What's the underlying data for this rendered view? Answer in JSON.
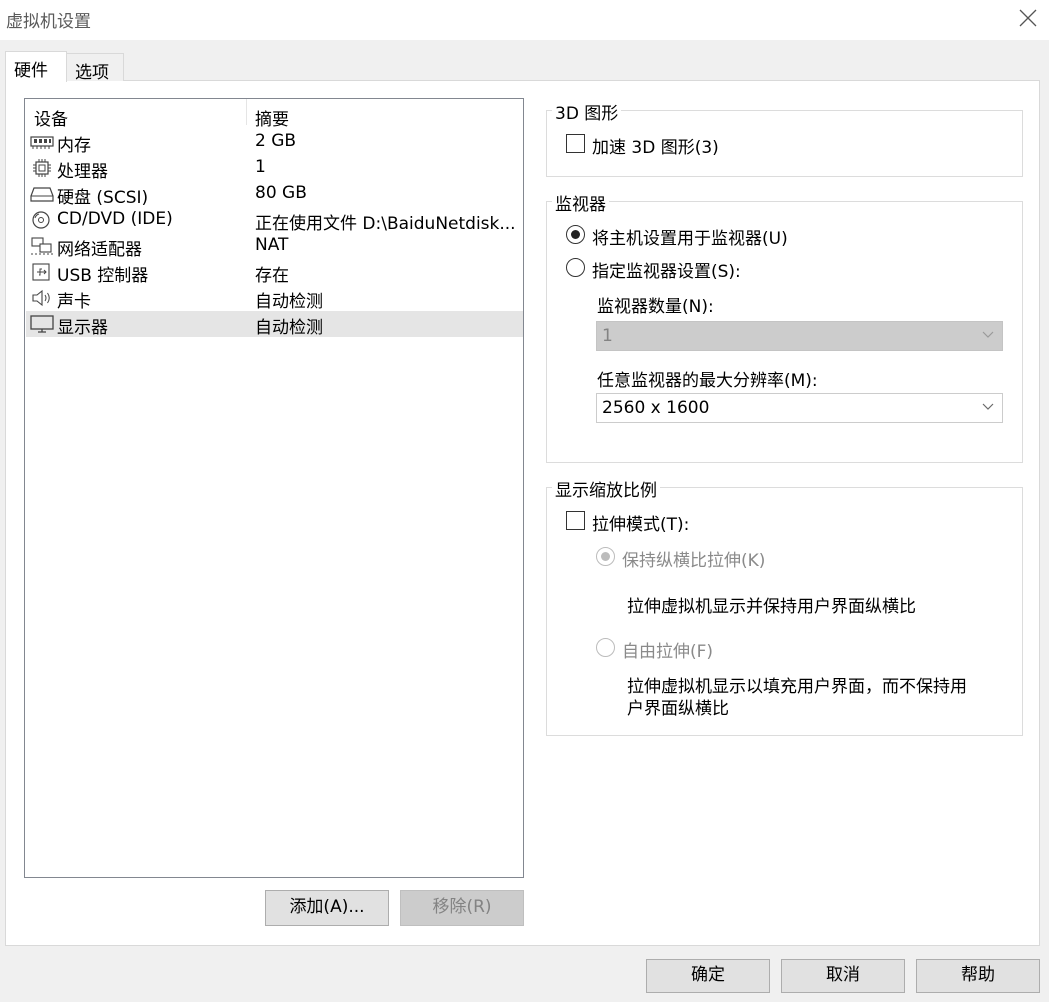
{
  "window": {
    "title": "虚拟机设置"
  },
  "tabs": [
    {
      "label": "硬件",
      "selected": true
    },
    {
      "label": "选项",
      "selected": false
    }
  ],
  "device_list": {
    "headers": {
      "device": "设备",
      "summary": "摘要"
    },
    "rows": [
      {
        "name": "内存",
        "summary": "2 GB",
        "icon": "memory-icon"
      },
      {
        "name": "处理器",
        "summary": "1",
        "icon": "processor-icon"
      },
      {
        "name": "硬盘 (SCSI)",
        "summary": "80 GB",
        "icon": "hard-disk-icon"
      },
      {
        "name": "CD/DVD (IDE)",
        "summary": "正在使用文件 D:\\BaiduNetdisk...",
        "icon": "cd-dvd-icon"
      },
      {
        "name": "网络适配器",
        "summary": "NAT",
        "icon": "network-adapter-icon"
      },
      {
        "name": "USB 控制器",
        "summary": "存在",
        "icon": "usb-icon"
      },
      {
        "name": "声卡",
        "summary": "自动检测",
        "icon": "speaker-icon"
      },
      {
        "name": "显示器",
        "summary": "自动检测",
        "icon": "display-icon",
        "selected": true
      }
    ]
  },
  "list_buttons": {
    "add": "添加(A)...",
    "remove": "移除(R)"
  },
  "graphics_3d": {
    "title": "3D 图形",
    "accelerate_label": "加速 3D 图形(3)",
    "accelerate_checked": false
  },
  "monitor": {
    "title": "监视器",
    "use_host_label": "将主机设置用于监视器(U)",
    "use_host_selected": true,
    "specify_label": "指定监视器设置(S):",
    "specify_selected": false,
    "count_label": "监视器数量(N):",
    "count_value": "1",
    "max_res_label": "任意监视器的最大分辨率(M):",
    "max_res_value": "2560 x 1600"
  },
  "display_scaling": {
    "title": "显示缩放比例",
    "stretch_label": "拉伸模式(T):",
    "stretch_checked": false,
    "keep_aspect_label": "保持纵横比拉伸(K)",
    "keep_aspect_selected": true,
    "keep_aspect_desc": "拉伸虚拟机显示并保持用户界面纵横比",
    "free_label": "自由拉伸(F)",
    "free_selected": false,
    "free_desc_line1": "拉伸虚拟机显示以填充用户界面，而不保持用",
    "free_desc_line2": "户界面纵横比"
  },
  "dialog_buttons": {
    "ok": "确定",
    "cancel": "取消",
    "help": "帮助"
  }
}
